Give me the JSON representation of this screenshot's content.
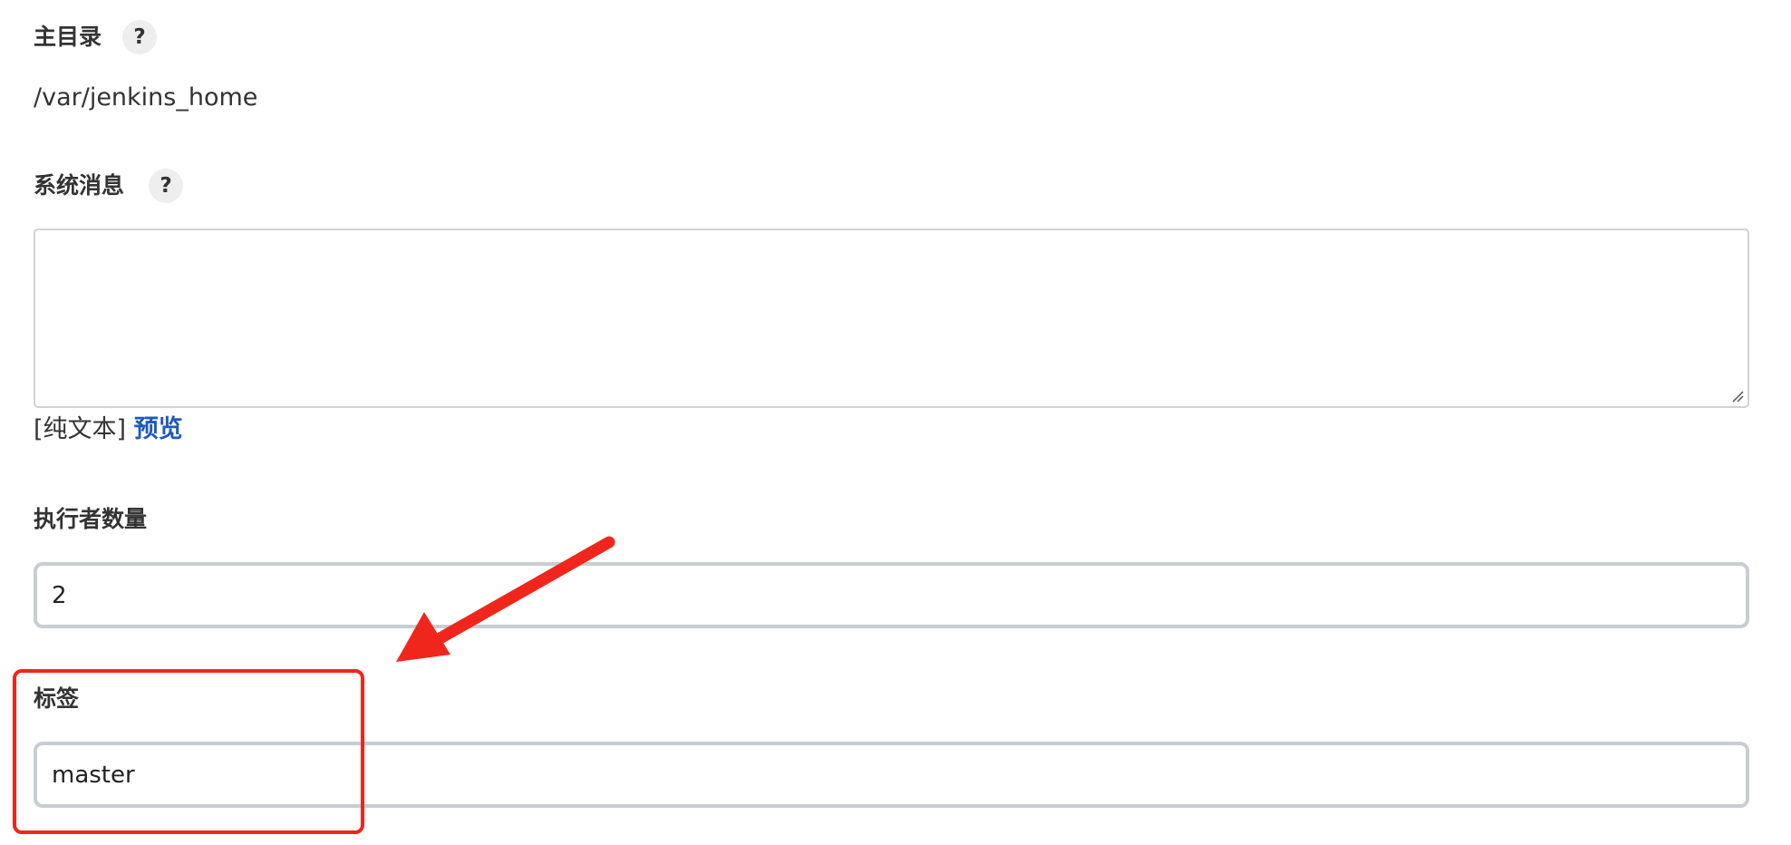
{
  "fields": {
    "home_dir": {
      "label": "主目录",
      "help_icon": "question-mark-icon",
      "help_glyph": "?",
      "value": "/var/jenkins_home"
    },
    "system_message": {
      "label": "系统消息",
      "help_icon": "question-mark-icon",
      "help_glyph": "?",
      "value": "",
      "format_prefix": "[纯文本]",
      "preview_link": "预览"
    },
    "executors": {
      "label": "执行者数量",
      "value": "2"
    },
    "labels": {
      "label": "标签",
      "value": "master"
    }
  },
  "annotation": {
    "color": "#f0261c",
    "arrow_icon": "arrow-icon"
  },
  "colors": {
    "link": "#1f5ab8",
    "text": "#333333",
    "border": "#c8cdd3"
  }
}
